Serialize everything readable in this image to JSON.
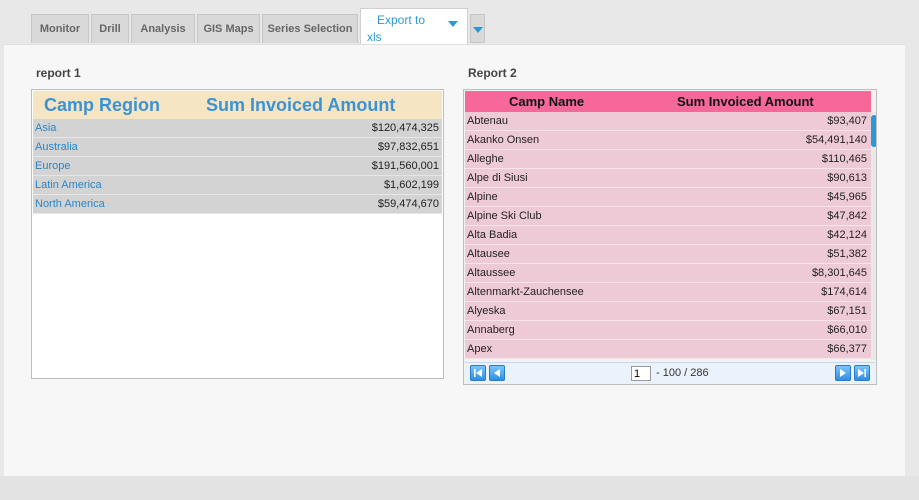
{
  "tabs": [
    {
      "label": "Monitor"
    },
    {
      "label": "Drill"
    },
    {
      "label": "Analysis"
    },
    {
      "label": "GIS Maps"
    },
    {
      "label": "Series Selection"
    }
  ],
  "export": {
    "line1": "Export to",
    "line2": "xls"
  },
  "report1": {
    "title": "report 1",
    "headers": [
      "Camp Region",
      "Sum Invoiced Amount"
    ],
    "rows": [
      {
        "region": "Asia",
        "amount": "$120,474,325"
      },
      {
        "region": "Australia",
        "amount": "$97,832,651"
      },
      {
        "region": "Europe",
        "amount": "$191,560,001"
      },
      {
        "region": "Latin America",
        "amount": "$1,602,199"
      },
      {
        "region": "North America",
        "amount": "$59,474,670"
      }
    ]
  },
  "report2": {
    "title": "Report 2",
    "headers": [
      "Camp Name",
      "Sum Invoiced Amount"
    ],
    "rows": [
      {
        "name": "Abtenau",
        "amount": "$93,407"
      },
      {
        "name": "Akanko Onsen",
        "amount": "$54,491,140"
      },
      {
        "name": "Alleghe",
        "amount": "$110,465"
      },
      {
        "name": "Alpe di Siusi",
        "amount": "$90,613"
      },
      {
        "name": "Alpine",
        "amount": "$45,965"
      },
      {
        "name": "Alpine Ski Club",
        "amount": "$47,842"
      },
      {
        "name": "Alta Badia",
        "amount": "$42,124"
      },
      {
        "name": "Altausee",
        "amount": "$51,382"
      },
      {
        "name": "Altaussee",
        "amount": "$8,301,645"
      },
      {
        "name": "Altenmarkt-Zauchensee",
        "amount": "$174,614"
      },
      {
        "name": "Alyeska",
        "amount": "$67,151"
      },
      {
        "name": "Annaberg",
        "amount": "$66,010"
      },
      {
        "name": "Apex",
        "amount": "$66,377"
      }
    ],
    "pager": {
      "page": "1",
      "range": "- 100 / 286"
    }
  },
  "colors": {
    "accent": "#2a9ad6",
    "report1_header": "#f6e5c3",
    "report2_header": "#f7679a",
    "report2_row": "#eecad6"
  }
}
